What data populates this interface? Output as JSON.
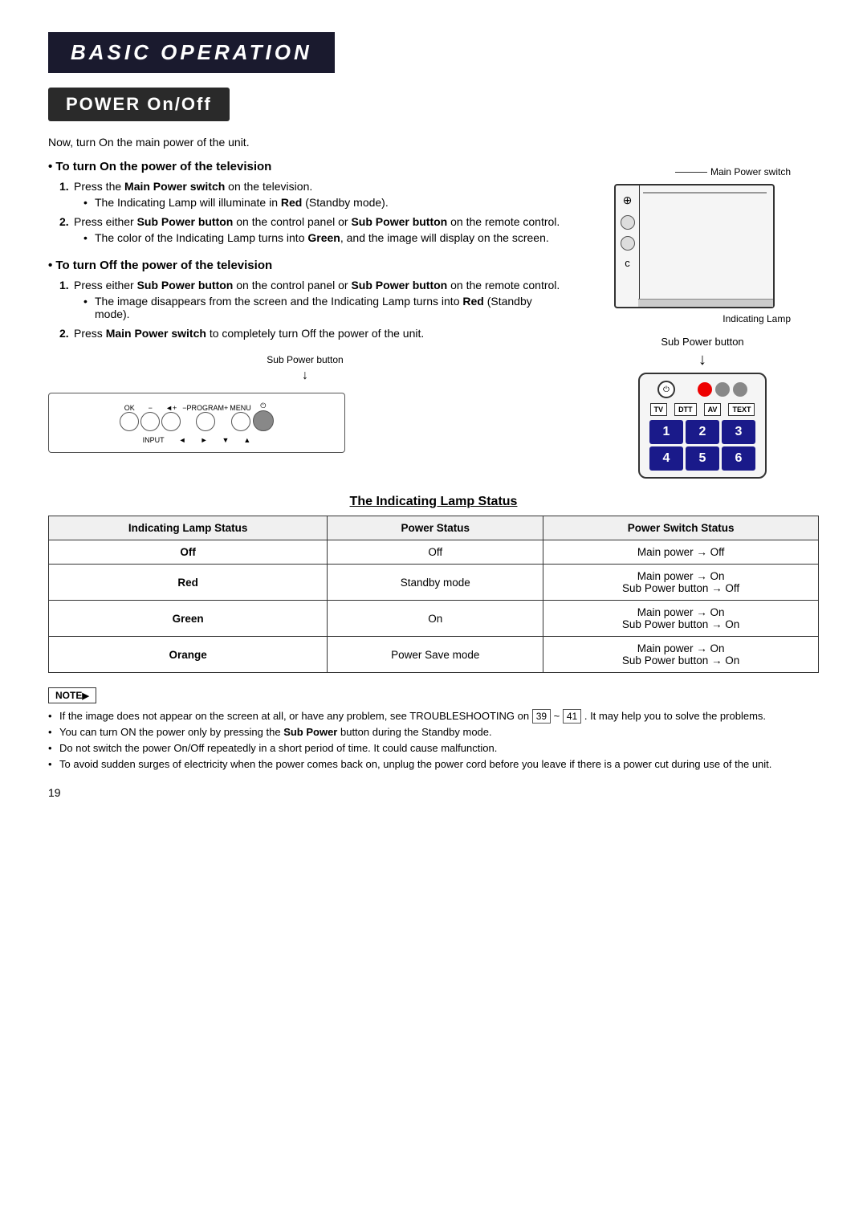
{
  "page": {
    "title": "BASIC OPERATION",
    "section": "POWER On/Off",
    "page_number": "19"
  },
  "intro": "Now, turn On the main power of the unit.",
  "turn_on": {
    "heading": "To turn On the power of the television",
    "steps": [
      {
        "text": "Press the Main Power switch on the television.",
        "bold_parts": [
          "Main Power switch"
        ],
        "sub": "The Indicating Lamp will illuminate in Red (Standby mode)."
      },
      {
        "text": "Press either Sub Power button on the control panel or Sub Power button on the remote control.",
        "bold_parts": [
          "Sub Power button",
          "Sub Power"
        ],
        "sub": "The color of the Indicating Lamp turns into Green, and the image will display on the screen."
      }
    ]
  },
  "turn_off": {
    "heading": "To turn Off the power of the television",
    "steps": [
      {
        "text": "Press either Sub Power button on the control panel or Sub Power button on the remote control.",
        "bold_parts": [
          "Sub Power button",
          "Sub Power"
        ],
        "sub": "The image disappears from the screen and the Indicating Lamp turns into Red (Standby mode)."
      },
      {
        "text": "Press Main Power switch to completely turn Off the power of the unit.",
        "bold_parts": [
          "Main Power switch"
        ]
      }
    ]
  },
  "panel_diagram": {
    "label_above": "Sub Power button",
    "buttons": [
      "OK",
      "−",
      "◄+",
      "−PROGRAM+",
      "MENU",
      "⏻"
    ],
    "sub_labels": [
      "INPUT",
      "◄",
      "►",
      "▼",
      "▲"
    ]
  },
  "tv_diagram": {
    "main_power_label": "Main Power switch",
    "indicating_lamp_label": "Indicating Lamp",
    "side_buttons": [
      "⊕",
      "○",
      "○",
      "○c"
    ]
  },
  "remote_diagram": {
    "label": "Sub Power button",
    "source_buttons": [
      "TV",
      "DTT",
      "AV",
      "TEXT"
    ],
    "number_buttons": [
      "1",
      "2",
      "3",
      "4",
      "5",
      "6"
    ]
  },
  "table": {
    "heading": "The Indicating Lamp Status",
    "columns": [
      "Indicating Lamp Status",
      "Power Status",
      "Power Switch Status"
    ],
    "rows": [
      {
        "lamp": "Off",
        "power": "Off",
        "switch": "Main power → Off"
      },
      {
        "lamp": "Red",
        "power": "Standby mode",
        "switch": "Main power → On\nSub Power button → Off"
      },
      {
        "lamp": "Green",
        "power": "On",
        "switch": "Main power → On\nSub Power button → On"
      },
      {
        "lamp": "Orange",
        "power": "Power Save mode",
        "switch": "Main power → On\nSub Power button → On"
      }
    ]
  },
  "notes": {
    "label": "NOTE",
    "items": [
      "If the image does not appear on the screen at all, or have any problem, see TROUBLESHOOTING on 39 ~ 41 . It may help you to solve the problems.",
      "You can turn ON the power only by pressing the Sub Power button during the Standby mode.",
      "Do not switch the power On/Off repeatedly in a short period of time. It could cause malfunction.",
      "To avoid sudden surges of electricity when the power comes back on, unplug the power cord before you leave if there is a power cut during use of the unit."
    ]
  }
}
